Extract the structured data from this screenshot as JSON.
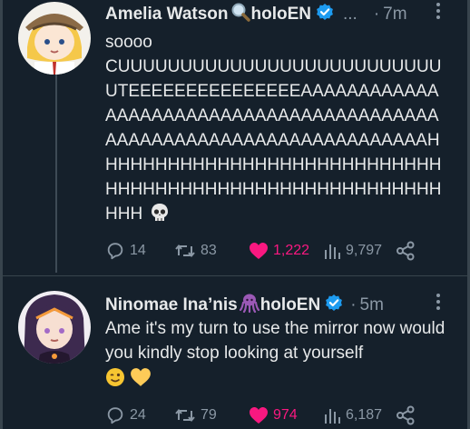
{
  "tweets": [
    {
      "author_name": "Amelia Watson",
      "author_affiliation": "holoEN",
      "truncation": "...",
      "separator": "·",
      "time": "7m",
      "text_line1": "soooo",
      "text_scream": "CUUUUUUUUUUUUUUUUUUUUUUUUUUUTEEEEEEEEEEEEEEEAAAAAAAAAAAAAAAAAAAAAAAAAAAAAAAAAAAAAAAAAAAAAAAAAAAAAAAAAAAAAAAAAAAAAHHHHHHHHHHHHHHHHHHHHHHHHHHHHHHHHHHHHHHHHHHHHHHHHHHHHHHHHHH",
      "emoji": "skull",
      "replies": "14",
      "retweets": "83",
      "likes": "1,222",
      "views": "9,797",
      "like_color": "#f91880"
    },
    {
      "author_name": "Ninomae Ina’nis",
      "author_affiliation": "holoEN",
      "separator": "·",
      "time": "5m",
      "text": "Ame it's my turn to use the mirror now would you kindly stop looking at yourself",
      "emoji": "winking-face yellow-heart",
      "replies": "24",
      "retweets": "79",
      "likes": "974",
      "views": "6,187",
      "like_color": "#f91880"
    }
  ],
  "colors": {
    "background": "#15202b",
    "verified": "#1d9bf0",
    "muted": "#8b98a5",
    "like": "#f91880"
  }
}
